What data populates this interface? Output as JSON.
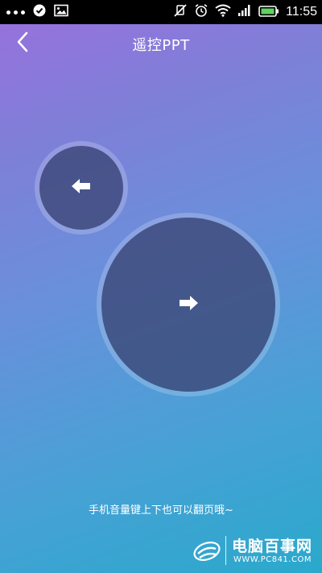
{
  "status_bar": {
    "time": "11:55",
    "icons": [
      "more-dots-icon",
      "check-circle-icon",
      "image-icon",
      "mute-icon",
      "alarm-icon",
      "wifi-icon",
      "signal-icon",
      "battery-icon"
    ]
  },
  "app_bar": {
    "title": "遥控PPT",
    "back_icon": "chevron-left-icon"
  },
  "controls": {
    "prev_icon": "arrow-left-icon",
    "next_icon": "arrow-right-icon"
  },
  "hint_text": "手机音量键上下也可以翻页哦~",
  "watermark": {
    "title": "电脑百事网",
    "url": "WWW.PC841.COM"
  },
  "colors": {
    "gradient_top": "#9a6fdd",
    "gradient_bottom": "#2aa9cc",
    "circle_fill": "#2d3769",
    "text": "#ffffff"
  }
}
